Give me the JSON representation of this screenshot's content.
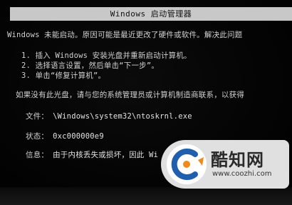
{
  "window": {
    "title": "Windows 启动管理器"
  },
  "body": {
    "message": "Windows 未能启动。原因可能是最近更改了硬件或软件。解决此问题",
    "steps": [
      "1. 插入 Windows 安装光盘并重新启动计算机。",
      "2. 选择语言设置，然后单击“下一步”。",
      "3. 单击“修复计算机”。"
    ],
    "no_disc_message": "如果没有此光盘，请与您的系统管理员或计算机制造商联系，以获得"
  },
  "details": {
    "file_label": "文件：",
    "file_value": "\\Windows\\system32\\ntoskrnl.exe",
    "status_label": "状态：",
    "status_value": "0xc000000e9",
    "info_label": "信息：",
    "info_value": "由于内核丢失或损坏，因此 Wi"
  },
  "watermark": {
    "brand": "酷知网",
    "url": "www.coozhi.com",
    "logo_icon": "coozhi-c-logo-icon"
  },
  "colors": {
    "background": "#030303",
    "title_bar": "#c8c8c8",
    "text": "#d0d0d0",
    "logo_blue": "#1f5fae",
    "logo_orange": "#f08a1c"
  }
}
